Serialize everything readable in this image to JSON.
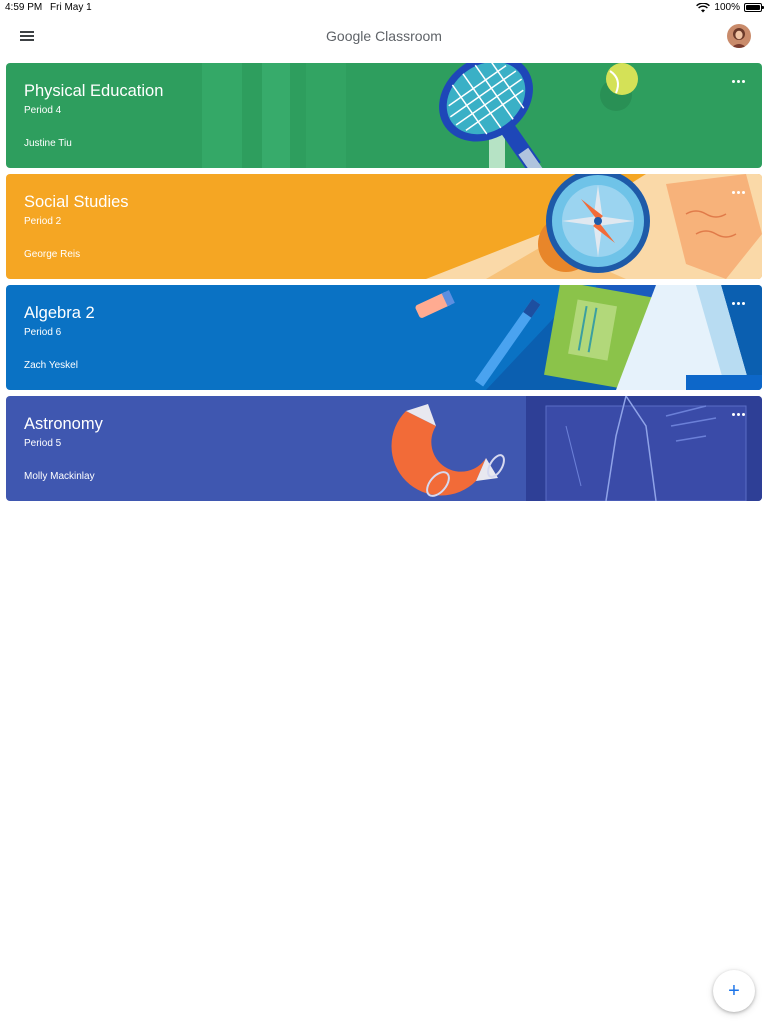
{
  "status_bar": {
    "time": "4:59 PM",
    "date": "Fri May 1",
    "battery": "100%",
    "wifi_icon": "wifi-icon",
    "battery_icon": "battery-icon"
  },
  "app_bar": {
    "title": "Google Classroom",
    "menu_icon": "hamburger-menu-icon",
    "avatar": "profile-avatar"
  },
  "classes": [
    {
      "name": "Physical Education",
      "section": "Period 4",
      "teacher": "Justine Tiu",
      "color": "#2e9e5e",
      "illustration": "tennis-racket-and-ball"
    },
    {
      "name": "Social Studies",
      "section": "Period 2",
      "teacher": "George Reis",
      "color": "#f5a623",
      "illustration": "compass-and-map"
    },
    {
      "name": "Algebra 2",
      "section": "Period 6",
      "teacher": "Zach Yeskel",
      "color": "#0a72c4",
      "illustration": "pen-and-books"
    },
    {
      "name": "Astronomy",
      "section": "Period 5",
      "teacher": "Molly Mackinlay",
      "color": "#3f57b0",
      "illustration": "magnet-and-rocket-blueprint"
    }
  ],
  "more_icon": "more-horizontal-icon",
  "fab": {
    "label": "+",
    "icon": "plus-icon"
  },
  "colors": {
    "accent": "#1a73e8"
  }
}
